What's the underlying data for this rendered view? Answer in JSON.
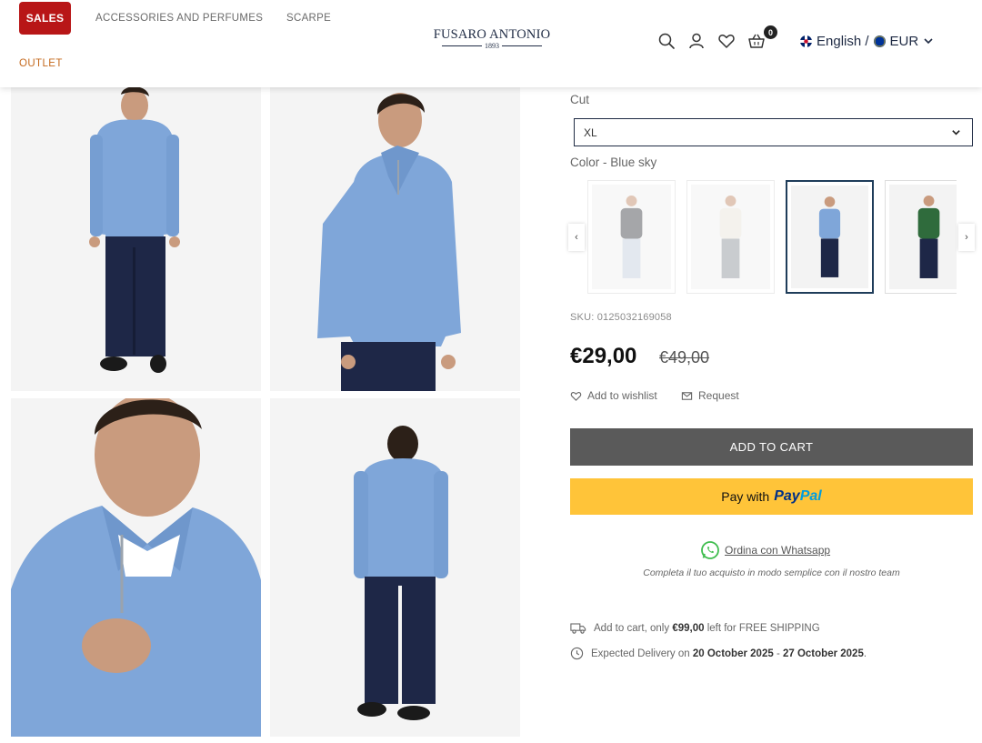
{
  "header": {
    "sales_label": "SALES",
    "nav": [
      "ACCESSORIES AND PERFUMES",
      "SCARPE"
    ],
    "outlet_label": "OUTLET",
    "logo_name": "FUSARO ANTONIO",
    "logo_year": "1893",
    "cart_count": "0",
    "language": "English /",
    "currency": "EUR",
    "icons": [
      "search-icon",
      "user-icon",
      "heart-icon",
      "basket-icon",
      "chevron-down-icon"
    ]
  },
  "product": {
    "cut_label": "Cut",
    "cut_value": "XL",
    "color_label": "Color - Blue sky",
    "swatches": [
      {
        "name": "gray",
        "sweater": "#5c5f63",
        "pants": "#cdd6e2"
      },
      {
        "name": "cream",
        "sweater": "#ece8df",
        "pants": "#9ea3a8"
      },
      {
        "name": "blue-sky",
        "sweater": "#7fa6d9",
        "pants": "#1e2747"
      },
      {
        "name": "green",
        "sweater": "#2f6b3c",
        "pants": "#1e2747"
      }
    ],
    "sku": "SKU: 0125032169058",
    "price": "€29,00",
    "old_price": "€49,00",
    "wishlist_label": "Add to wishlist",
    "request_label": "Request",
    "add_to_cart": "ADD TO CART",
    "paypal_prefix": "Pay with",
    "paypal_pay": "Pay",
    "paypal_pal": "Pal",
    "whatsapp_label": "Ordina con Whatsapp",
    "whatsapp_note": "Completa il tuo acquisto in modo semplice con il nostro team",
    "shipping_pre": "Add to cart, only",
    "shipping_amount": "€99,00",
    "shipping_post": "left for FREE SHIPPING",
    "delivery_pre": "Expected Delivery on",
    "delivery_start": "20 October 2025",
    "delivery_sep": "-",
    "delivery_end": "27 October 2025",
    "delivery_end_punct": "."
  },
  "colors": {
    "sales_red": "#b81617",
    "brand_navy": "#1f2b44",
    "outlet_orange": "#c56a1f",
    "add_to_cart_bg": "#5a5a5a",
    "paypal_yellow": "#ffc439",
    "sweater_blue": "#7fa6d9"
  }
}
